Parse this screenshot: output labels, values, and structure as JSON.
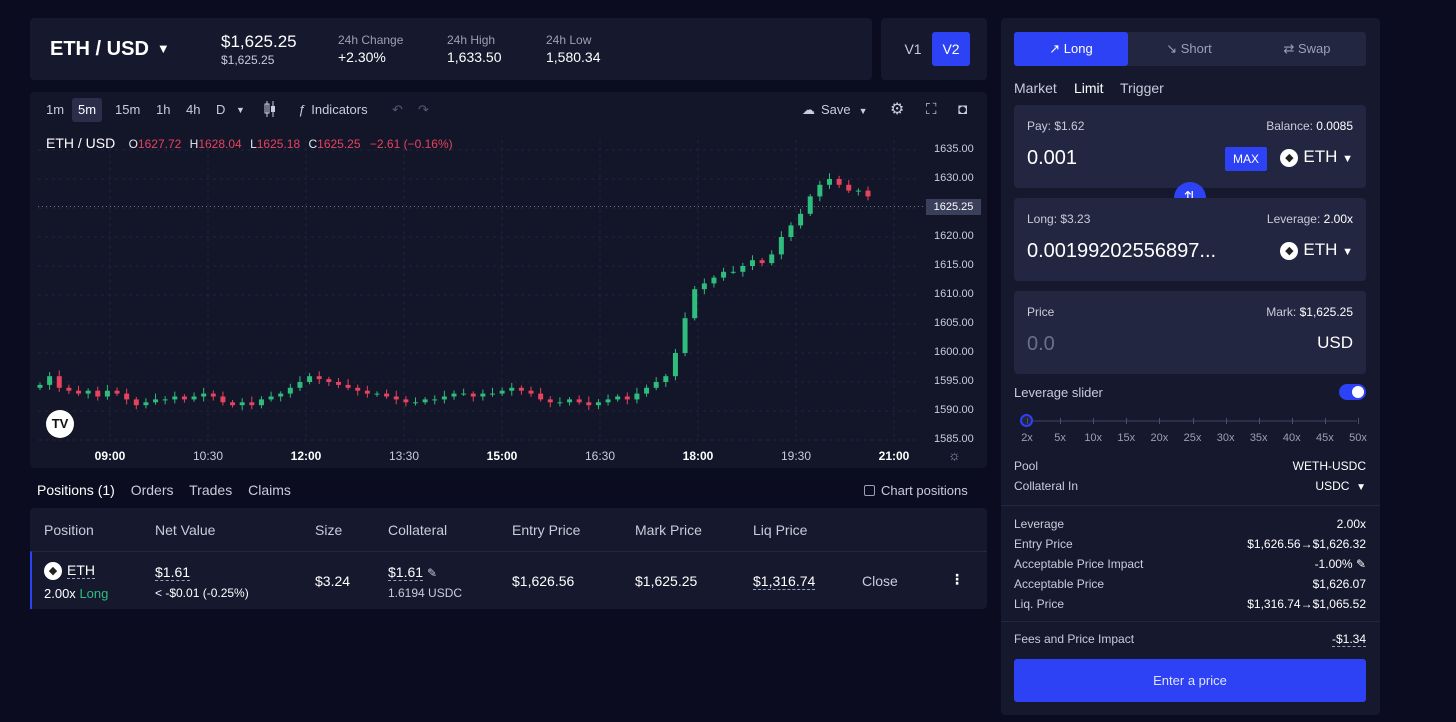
{
  "header": {
    "pair": "ETH / USD",
    "price_main": "$1,625.25",
    "price_sub": "$1,625.25",
    "stats": [
      {
        "label": "24h Change",
        "value": "+2.30%"
      },
      {
        "label": "24h High",
        "value": "1,633.50"
      },
      {
        "label": "24h Low",
        "value": "1,580.34"
      }
    ]
  },
  "version": {
    "v1": "V1",
    "v2": "V2"
  },
  "toolbar": {
    "intervals": [
      "1m",
      "5m",
      "15m",
      "1h",
      "4h",
      "D"
    ],
    "selected_interval": "5m",
    "indicators": "Indicators",
    "save": "Save"
  },
  "chart_data": {
    "type": "candlestick",
    "symbol": "ETH / USD",
    "ohlc": {
      "O": "1627.72",
      "H": "1628.04",
      "L": "1625.18",
      "C": "1625.25",
      "change": "−2.61 (−0.16%)"
    },
    "current_price_label": "1625.25",
    "y_ticks": [
      "1635.00",
      "1630.00",
      "1625.00",
      "1620.00",
      "1615.00",
      "1610.00",
      "1605.00",
      "1600.00",
      "1595.00",
      "1590.00",
      "1585.00"
    ],
    "ylim": [
      1585,
      1635
    ],
    "x_ticks": [
      {
        "label": "09:00",
        "bold": true
      },
      {
        "label": "10:30",
        "bold": false
      },
      {
        "label": "12:00",
        "bold": true
      },
      {
        "label": "13:30",
        "bold": false
      },
      {
        "label": "15:00",
        "bold": true
      },
      {
        "label": "16:30",
        "bold": false
      },
      {
        "label": "18:00",
        "bold": true
      },
      {
        "label": "19:30",
        "bold": false
      },
      {
        "label": "21:00",
        "bold": true
      }
    ],
    "close_path": [
      1594.5,
      1596,
      1594,
      1593.5,
      1593,
      1593.5,
      1592.5,
      1593.5,
      1593,
      1592,
      1591,
      1591.5,
      1592,
      1592,
      1592.5,
      1592,
      1592.5,
      1593,
      1592.5,
      1591.5,
      1591,
      1591.5,
      1591,
      1592,
      1592.5,
      1593,
      1594,
      1595,
      1596,
      1595.5,
      1595,
      1594.5,
      1594,
      1593.5,
      1593,
      1593,
      1592.5,
      1592,
      1591.5,
      1591.5,
      1592,
      1592,
      1592.5,
      1593,
      1593,
      1592.5,
      1593,
      1593,
      1593.5,
      1594,
      1593.5,
      1593,
      1592,
      1591.5,
      1591.5,
      1592,
      1591.5,
      1591,
      1591.5,
      1592,
      1592.5,
      1592,
      1593,
      1594,
      1595,
      1596,
      1600,
      1606,
      1611,
      1612,
      1613,
      1614,
      1614,
      1615,
      1616,
      1615.5,
      1617,
      1620,
      1622,
      1624,
      1627,
      1629,
      1630,
      1629,
      1628,
      1628,
      1627
    ],
    "annotation": "TV"
  },
  "positions": {
    "tabs": [
      "Positions (1)",
      "Orders",
      "Trades",
      "Claims"
    ],
    "chart_positions": "Chart positions",
    "columns": [
      "Position",
      "Net Value",
      "Size",
      "Collateral",
      "Entry Price",
      "Mark Price",
      "Liq Price"
    ],
    "row": {
      "token": "ETH",
      "leverage": "2.00x",
      "side": "Long",
      "net_value": "$1.61",
      "pnl": "< -$0.01 (-0.25%)",
      "size": "$3.24",
      "collateral": "$1.61",
      "collateral_sub": "1.6194 USDC",
      "entry": "$1,626.56",
      "mark": "$1,625.25",
      "liq": "$1,316.74",
      "close": "Close"
    }
  },
  "order": {
    "tabs": [
      "Long",
      "Short",
      "Swap"
    ],
    "types": [
      "Market",
      "Limit",
      "Trigger"
    ],
    "pay": {
      "label": "Pay: $1.62",
      "balance_label": "Balance: ",
      "balance": "0.0085",
      "value": "0.001",
      "max": "MAX",
      "token": "ETH"
    },
    "long": {
      "label": "Long: $3.23",
      "leverage_label": "Leverage: ",
      "leverage": "2.00x",
      "value": "0.00199202556897...",
      "token": "ETH"
    },
    "price": {
      "label": "Price",
      "mark_label": "Mark: ",
      "mark": "$1,625.25",
      "placeholder": "0.0",
      "unit": "USD"
    },
    "leverage_slider": "Leverage slider",
    "slider_marks": [
      "2x",
      "5x",
      "10x",
      "15x",
      "20x",
      "25x",
      "30x",
      "35x",
      "40x",
      "45x",
      "50x"
    ],
    "pool_label": "Pool",
    "pool": "WETH-USDC",
    "collateral_label": "Collateral In",
    "collateral": "USDC",
    "details": [
      {
        "label": "Leverage",
        "value": "2.00x"
      },
      {
        "label": "Entry Price",
        "value": "$1,626.56→$1,626.32"
      },
      {
        "label": "Acceptable Price Impact",
        "value": "-1.00%"
      },
      {
        "label": "Acceptable Price",
        "value": "$1,626.07"
      },
      {
        "label": "Liq. Price",
        "value": "$1,316.74→$1,065.52"
      }
    ],
    "fees_label": "Fees and Price Impact",
    "fees": "-$1.34",
    "submit": "Enter a price"
  }
}
